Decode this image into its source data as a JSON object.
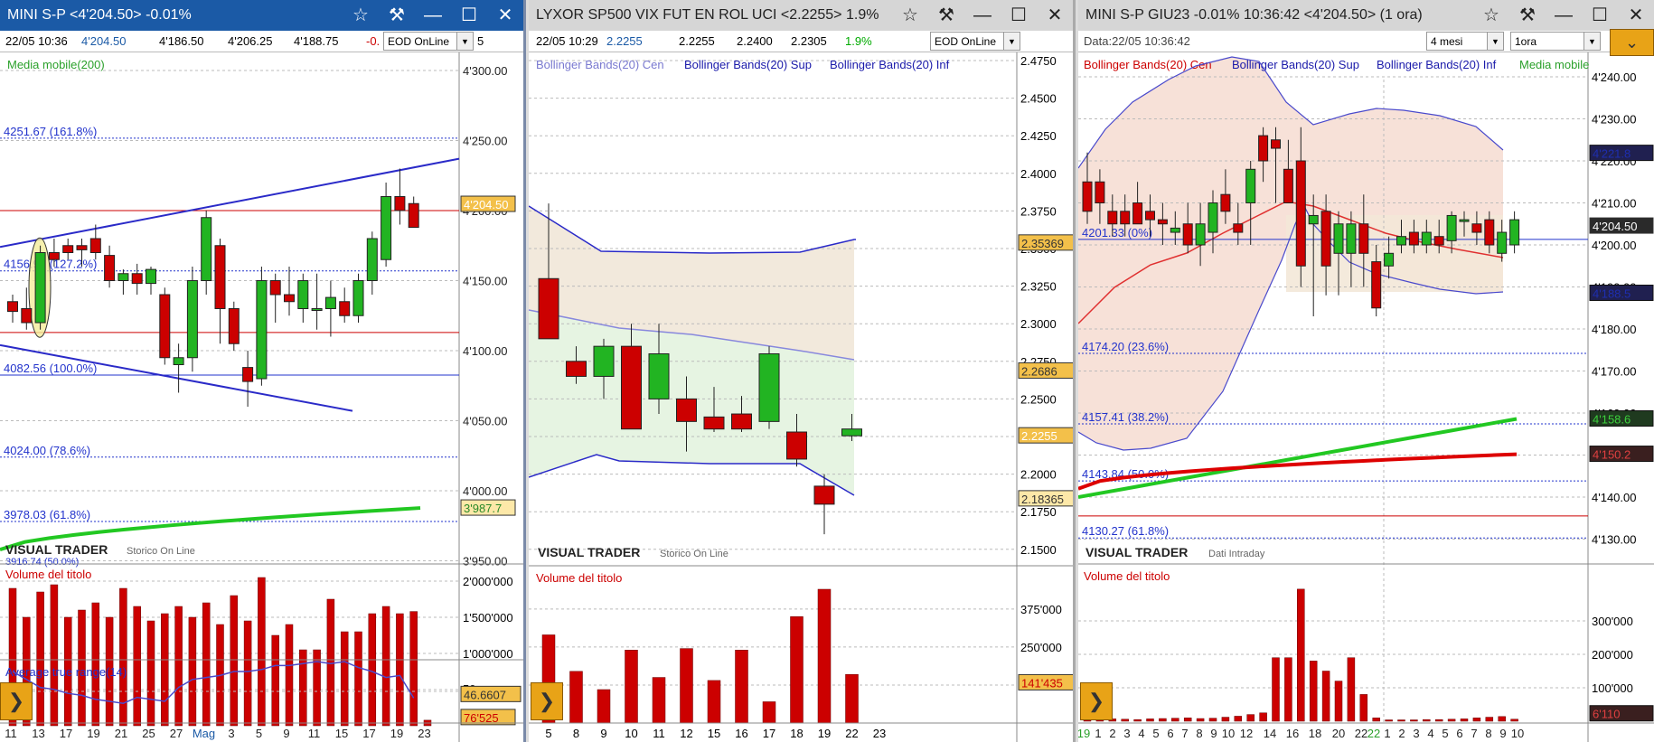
{
  "colors": {
    "up": "#22b422",
    "down": "#cc0000",
    "border": "#666",
    "blueTitle": "#1b5aa6",
    "grayTitle": "#d6d6d6",
    "gold": "#f3c04a",
    "grid": "#bbbbbb",
    "maRed": "#e60000",
    "maGreen": "#22c822"
  },
  "panel1": {
    "title": "MINI S-P <4'204.50> -0.01%",
    "info": {
      "date": "22/05 10:36",
      "last": "4'204.50",
      "open": "4'186.50",
      "high": "4'206.25",
      "low": "4'188.75",
      "chg": "-0.",
      "tail": "5"
    },
    "select": "EOD OnLine",
    "indicator": "Media mobile(200)",
    "yticks": [
      "4'300.00",
      "4'250.00",
      "4'200.00",
      "4'150.00",
      "4'100.00",
      "4'050.00",
      "4'000.00",
      "3'950.00"
    ],
    "levels": [
      {
        "label": "4251.67 (161.8%)"
      },
      {
        "label": "4156.96 (127.2%)"
      },
      {
        "label": "4082.56 (100.0%)"
      },
      {
        "label": "4024.00 (78.6%)"
      },
      {
        "label": "3978.03 (61.8%)"
      }
    ],
    "priceTag": "4'204.50",
    "maTag": "3'987.7",
    "brand": "VISUAL TRADER",
    "brandSub": "Storico On Line",
    "cutoffLabel": "3916.74 (50.0%)",
    "volTitle": "Volume del titolo",
    "volTicks": [
      "2'000'000",
      "1'500'000",
      "1'000'000",
      "500'000"
    ],
    "volTag": "76'525",
    "atrTitle": "Average true range(14)",
    "atrTick": "50",
    "atrTag": "46.6607",
    "xticks": [
      "11",
      "13",
      "17",
      "19",
      "21",
      "25",
      "27",
      "Mag",
      "3",
      "5",
      "9",
      "11",
      "15",
      "17",
      "19",
      "23"
    ]
  },
  "panel2": {
    "title": "LYXOR SP500 VIX FUT EN ROL UCI <2.2255> 1.9%",
    "info": {
      "date": "22/05 10:29",
      "last": "2.2255",
      "open": "2.2255",
      "high": "2.2400",
      "low": "2.2305",
      "chg": "1.9%"
    },
    "select": "EOD OnLine",
    "legend": [
      "Bollinger Bands(20) Cen",
      "Bollinger Bands(20) Sup",
      "Bollinger Bands(20) Inf"
    ],
    "yticks": [
      "2.4750",
      "2.4500",
      "2.4250",
      "2.4000",
      "2.3750",
      "2.3500",
      "2.3250",
      "2.3000",
      "2.2750",
      "2.2500",
      "2.2250",
      "2.2000",
      "2.1750",
      "2.1500"
    ],
    "tags": [
      "2.35369",
      "2.2686",
      "2.2255",
      "2.18365"
    ],
    "brand": "VISUAL TRADER",
    "brandSub": "Storico On Line",
    "volTitle": "Volume del titolo",
    "volTicks": [
      "375'000",
      "250'000",
      "125'000"
    ],
    "volTag": "141'435",
    "xticks": [
      "5",
      "8",
      "9",
      "10",
      "11",
      "12",
      "15",
      "16",
      "17",
      "18",
      "19",
      "22",
      "23"
    ]
  },
  "panel3": {
    "title": "MINI S-P GIU23 -0.01% 10:36:42 <4'204.50> (1 ora)",
    "info": {
      "date": "Data:22/05 10:36:42"
    },
    "select1": "4 mesi",
    "select2": "1ora",
    "legend": [
      "Bollinger Bands(20) Cen",
      "Bollinger Bands(20) Sup",
      "Bollinger Bands(20) Inf",
      "Media mobile"
    ],
    "yticks": [
      "4'240.00",
      "4'230.00",
      "4'220.00",
      "4'210.00",
      "4'200.00",
      "4'190.00",
      "4'180.00",
      "4'170.00",
      "4'160.00",
      "4'150.00",
      "4'140.00",
      "4'130.00"
    ],
    "levels": [
      {
        "label": "4201.33 (0%)"
      },
      {
        "label": "4174.20 (23.6%)"
      },
      {
        "label": "4157.41 (38.2%)"
      },
      {
        "label": "4143.84 (50.0%)"
      },
      {
        "label": "4130.27 (61.8%)"
      }
    ],
    "tags": [
      "4'221.8",
      "4'204.50",
      "4'188.5",
      "4'158.6",
      "4'150.2"
    ],
    "brand": "VISUAL TRADER",
    "brandSub": "Dati Intraday",
    "volTitle": "Volume del titolo",
    "volTicks": [
      "300'000",
      "200'000",
      "100'000"
    ],
    "volTag": "6'110",
    "xticks": [
      "19",
      "1",
      "2",
      "3",
      "4",
      "5",
      "6",
      "7",
      "8",
      "9",
      "10",
      "12",
      "14",
      "16",
      "18",
      "20",
      "22",
      "22",
      "1",
      "2",
      "3",
      "4",
      "5",
      "6",
      "7",
      "8",
      "9",
      "10"
    ]
  },
  "chart_data": [
    {
      "type": "candlestick",
      "panel": "MINI S-P daily",
      "ylim": [
        3940,
        4310
      ],
      "candles": [
        [
          4135,
          4140,
          4120,
          4128
        ],
        [
          4130,
          4145,
          4115,
          4120
        ],
        [
          4120,
          4175,
          4115,
          4170
        ],
        [
          4170,
          4180,
          4160,
          4165
        ],
        [
          4175,
          4180,
          4165,
          4170
        ],
        [
          4175,
          4180,
          4160,
          4172
        ],
        [
          4180,
          4190,
          4165,
          4170
        ],
        [
          4168,
          4175,
          4145,
          4150
        ],
        [
          4150,
          4158,
          4140,
          4155
        ],
        [
          4155,
          4162,
          4140,
          4148
        ],
        [
          4148,
          4160,
          4140,
          4158
        ],
        [
          4140,
          4145,
          4090,
          4095
        ],
        [
          4090,
          4105,
          4070,
          4095
        ],
        [
          4095,
          4160,
          4085,
          4150
        ],
        [
          4150,
          4200,
          4140,
          4195
        ],
        [
          4175,
          4180,
          4105,
          4130
        ],
        [
          4130,
          4135,
          4100,
          4105
        ],
        [
          4088,
          4100,
          4060,
          4078
        ],
        [
          4080,
          4160,
          4075,
          4150
        ],
        [
          4150,
          4155,
          4120,
          4140
        ],
        [
          4140,
          4160,
          4125,
          4135
        ],
        [
          4130,
          4155,
          4120,
          4150
        ],
        [
          4130,
          4155,
          4115,
          4130
        ],
        [
          4130,
          4150,
          4110,
          4138
        ],
        [
          4135,
          4145,
          4120,
          4125
        ],
        [
          4125,
          4155,
          4120,
          4150
        ],
        [
          4150,
          4185,
          4140,
          4180
        ],
        [
          4165,
          4220,
          4160,
          4210
        ],
        [
          4210,
          4230,
          4190,
          4200
        ],
        [
          4205,
          4210,
          4190,
          4188
        ]
      ],
      "ma200": {
        "from": 3958,
        "to": 3987.7
      },
      "volumes": [
        1900000,
        1500000,
        1850000,
        1950000,
        1500000,
        1600000,
        1700000,
        1500000,
        1900000,
        1650000,
        1450000,
        1550000,
        1650000,
        1500000,
        1700000,
        1400000,
        1800000,
        1450000,
        2050000,
        1250000,
        1400000,
        1050000,
        1050000,
        1750000,
        1300000,
        1300000,
        1550000,
        1650000,
        1550000,
        1580000,
        76525
      ],
      "atr": [
        60,
        56,
        52,
        51,
        49,
        48,
        46,
        45,
        44,
        47,
        46,
        45,
        52,
        56,
        57,
        58,
        60,
        60,
        61,
        63,
        63,
        64,
        65,
        64,
        65,
        62,
        60,
        57,
        58,
        46.66
      ]
    },
    {
      "type": "candlestick",
      "panel": "LYXOR VIX",
      "ylim": [
        2.14,
        2.48
      ],
      "candles": [
        [
          2.33,
          2.38,
          2.3,
          2.29
        ],
        [
          2.275,
          2.285,
          2.26,
          2.265
        ],
        [
          2.265,
          2.29,
          2.25,
          2.285
        ],
        [
          2.285,
          2.3,
          2.24,
          2.23
        ],
        [
          2.25,
          2.3,
          2.24,
          2.28
        ],
        [
          2.25,
          2.265,
          2.215,
          2.235
        ],
        [
          2.238,
          2.258,
          2.228,
          2.23
        ],
        [
          2.24,
          2.252,
          2.228,
          2.23
        ],
        [
          2.235,
          2.285,
          2.23,
          2.28
        ],
        [
          2.228,
          2.24,
          2.205,
          2.21
        ],
        [
          2.192,
          2.2,
          2.16,
          2.18
        ],
        [
          2.2255,
          2.24,
          2.222,
          2.23
        ]
      ],
      "bollinger": {
        "sup": [
          2.35,
          2.351,
          2.351,
          2.352,
          2.353,
          2.353
        ],
        "cen": [
          2.32,
          2.3,
          2.29,
          2.285,
          2.275,
          2.27
        ],
        "inf": [
          2.21,
          2.22,
          2.215,
          2.21,
          2.205,
          2.19
        ]
      },
      "volumes": [
        290000,
        170000,
        110000,
        240000,
        150000,
        245000,
        140000,
        240000,
        70000,
        350000,
        440000,
        160000
      ]
    },
    {
      "type": "candlestick",
      "panel": "MINI S-P GIU23 hourly",
      "ylim": [
        4126,
        4245
      ],
      "candles": [
        [
          4215,
          4222,
          4205,
          4208
        ],
        [
          4215,
          4218,
          4205,
          4210
        ],
        [
          4208,
          4212,
          4202,
          4205
        ],
        [
          4208,
          4212,
          4202,
          4205
        ],
        [
          4210,
          4215,
          4205,
          4205
        ],
        [
          4208,
          4212,
          4202,
          4206
        ],
        [
          4206,
          4210,
          4200,
          4205
        ],
        [
          4203,
          4208,
          4200,
          4204
        ],
        [
          4205,
          4210,
          4198,
          4200
        ],
        [
          4200,
          4210,
          4195,
          4205
        ],
        [
          4203,
          4213,
          4198,
          4210
        ],
        [
          4212,
          4218,
          4205,
          4208
        ],
        [
          4205,
          4210,
          4200,
          4203
        ],
        [
          4210,
          4220,
          4200,
          4218
        ],
        [
          4226,
          4228,
          4215,
          4220
        ],
        [
          4225,
          4228,
          4210,
          4223
        ],
        [
          4218,
          4225,
          4215,
          4210
        ],
        [
          4220,
          4228,
          4190,
          4195
        ],
        [
          4205,
          4212,
          4183,
          4207
        ],
        [
          4208,
          4212,
          4188,
          4195
        ],
        [
          4198,
          4208,
          4188,
          4205
        ],
        [
          4198,
          4208,
          4190,
          4205
        ],
        [
          4205,
          4212,
          4190,
          4198
        ],
        [
          4196,
          4200,
          4183,
          4185
        ],
        [
          4195,
          4202,
          4192,
          4198
        ],
        [
          4200,
          4206,
          4198,
          4202
        ],
        [
          4203,
          4206,
          4198,
          4200
        ],
        [
          4200,
          4206,
          4198,
          4203
        ],
        [
          4202,
          4206,
          4198,
          4200
        ],
        [
          4201,
          4208,
          4198,
          4207
        ],
        [
          4206,
          4208,
          4202,
          4206
        ],
        [
          4205,
          4208,
          4200,
          4203
        ],
        [
          4206,
          4208,
          4198,
          4200
        ],
        [
          4198,
          4206,
          4196,
          4203
        ],
        [
          4200,
          4208,
          4198,
          4206
        ]
      ],
      "bollinger": {
        "sup": [
          4200,
          4215,
          4225,
          4235,
          4240,
          4243,
          4245,
          4240,
          4236,
          4228,
          4218,
          4210,
          4210,
          4212,
          4213,
          4212,
          4210,
          4208,
          4200,
          4200,
          4196,
          4190,
          4186
        ],
        "cen": [
          4180,
          4185,
          4190,
          4195,
          4200,
          4205,
          4208,
          4210,
          4213,
          4214,
          4212,
          4210,
          4210,
          4208,
          4206,
          4205,
          4205,
          4202,
          4200,
          4200,
          4201,
          4202,
          4204
        ],
        "inf": [
          4160,
          4155,
          4148,
          4140,
          4135,
          4130,
          4145,
          4160,
          4175,
          4185,
          4195,
          4198,
          4200,
          4200,
          4199,
          4198,
          4193,
          4190,
          4190,
          4189,
          4188,
          4188,
          4188
        ]
      },
      "maGreen": {
        "from": 4140,
        "to": 4158.6
      },
      "maRed": {
        "from": 4142,
        "to": 4150.2
      },
      "volumes": [
        5000,
        8000,
        7000,
        6000,
        5000,
        7000,
        8000,
        9000,
        10000,
        8000,
        9000,
        12000,
        15000,
        20000,
        25000,
        190000,
        190000,
        395000,
        180000,
        150000,
        120000,
        190000,
        80000,
        10000,
        4000,
        4000,
        4000,
        5000,
        5000,
        6000,
        7000,
        10000,
        12000,
        14000,
        6110
      ]
    }
  ]
}
